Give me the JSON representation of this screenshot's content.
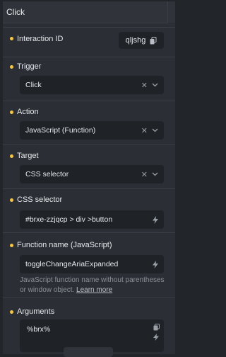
{
  "header": {
    "title": "Click"
  },
  "interaction_id": {
    "label": "Interaction ID",
    "value": "qljshg"
  },
  "trigger": {
    "label": "Trigger",
    "value": "Click"
  },
  "action": {
    "label": "Action",
    "value": "JavaScript (Function)"
  },
  "target": {
    "label": "Target",
    "value": "CSS selector"
  },
  "css_selector": {
    "label": "CSS selector",
    "value": "#brxe-zzjqcp > div >button"
  },
  "function_name": {
    "label": "Function name (JavaScript)",
    "value": "toggleChangeAriaExpanded",
    "help_text": "JavaScript function name without parentheses or window object.",
    "help_link": "Learn more"
  },
  "arguments": {
    "label": "Arguments",
    "value": "%brx%"
  },
  "colors": {
    "required_dot": "#f5c54a",
    "panel_bg": "#2b2f35",
    "field_bg": "#1f2226"
  }
}
